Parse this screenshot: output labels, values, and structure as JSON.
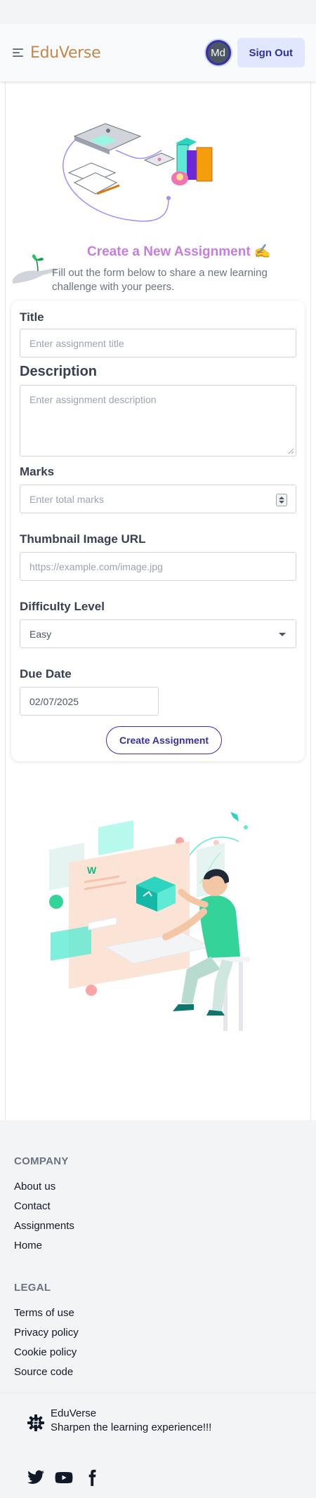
{
  "navbar": {
    "brand": "EduVerse",
    "avatar_initials": "Md",
    "signout_label": "Sign Out"
  },
  "hero": {
    "title": "Create a New Assignment ✍️",
    "subtitle": "Fill out the form below to share a new learning challenge with your peers."
  },
  "form": {
    "title_label": "Title",
    "title_placeholder": "Enter assignment title",
    "description_label": "Description",
    "description_placeholder": "Enter assignment description",
    "marks_label": "Marks",
    "marks_placeholder": "Enter total marks",
    "thumbnail_label": "Thumbnail Image URL",
    "thumbnail_placeholder": "https://example.com/image.jpg",
    "difficulty_label": "Difficulty Level",
    "difficulty_selected": "Easy",
    "due_label": "Due Date",
    "due_value": "02/07/2025",
    "submit_label": "Create Assignment"
  },
  "footer": {
    "company_heading": "COMPANY",
    "company_links": [
      "About us",
      "Contact",
      "Assignments",
      "Home"
    ],
    "legal_heading": "LEGAL",
    "legal_links": [
      "Terms of use",
      "Privacy policy",
      "Cookie policy",
      "Source code"
    ],
    "brand_name": "EduVerse",
    "tagline": "Sharpen the learning experience!!!",
    "social_icons": [
      "twitter-icon",
      "youtube-icon",
      "facebook-icon"
    ]
  },
  "colors": {
    "brand": "#c2884a",
    "accent": "#3730a3",
    "title": "#c77dde",
    "illustration_teal": "#4fd1b5",
    "illustration_peach": "#f9d5c5"
  }
}
